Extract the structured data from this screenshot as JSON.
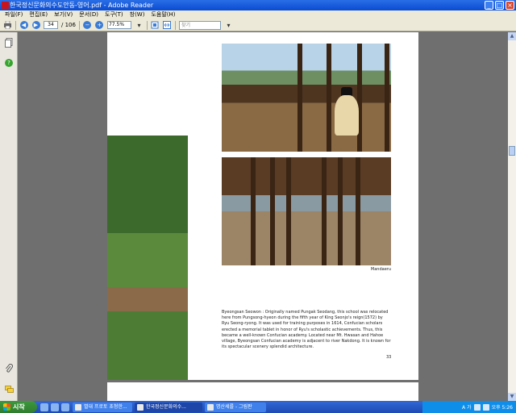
{
  "window": {
    "title": "한국정신문화의수도안동-영어.pdf - Adobe Reader",
    "buttons": [
      "_",
      "□",
      "×"
    ]
  },
  "menu": [
    "파일(F)",
    "편집(E)",
    "보기(V)",
    "문서(D)",
    "도구(T)",
    "창(W)",
    "도움말(H)"
  ],
  "toolbar": {
    "current_page": "34",
    "total_pages": "/ 106",
    "zoom": "77.5%",
    "search_placeholder": "찾기"
  },
  "document": {
    "caption": "Mandaeru",
    "body": "Byeongsan Seowon : Originally named Pungak Seodang, this school was relocated here from Pungsong-hyeon during the fifth year of King Seonjo's reign(1572) by Ryu Seong-ryong. It was used for training purposes in 1614, Confucian scholars erected a memorial tablet in honor of Ryu's scholastic achievements. Thus, this became a well-known Confucian academy. Located near Mt. Hwasan and Hahoe village, Byeongsan Confucian academy is adjacent to river Nakdong. It is known for its spectacular scenery splendid architecture.",
    "page_number": "33"
  },
  "taskbar": {
    "start_label": "시작",
    "tasks": [
      {
        "label": "별대 프로토 초청한...",
        "active": false
      },
      {
        "label": "한국정신문화의수...",
        "active": true
      },
      {
        "label": "명산세를 - 그림판",
        "active": false
      }
    ],
    "clock": "오후 5:26",
    "ime": "A 가"
  },
  "colors": {
    "titlebar": "#0a4bd1",
    "taskbar": "#1e4ab5",
    "start": "#3c9a3c"
  }
}
